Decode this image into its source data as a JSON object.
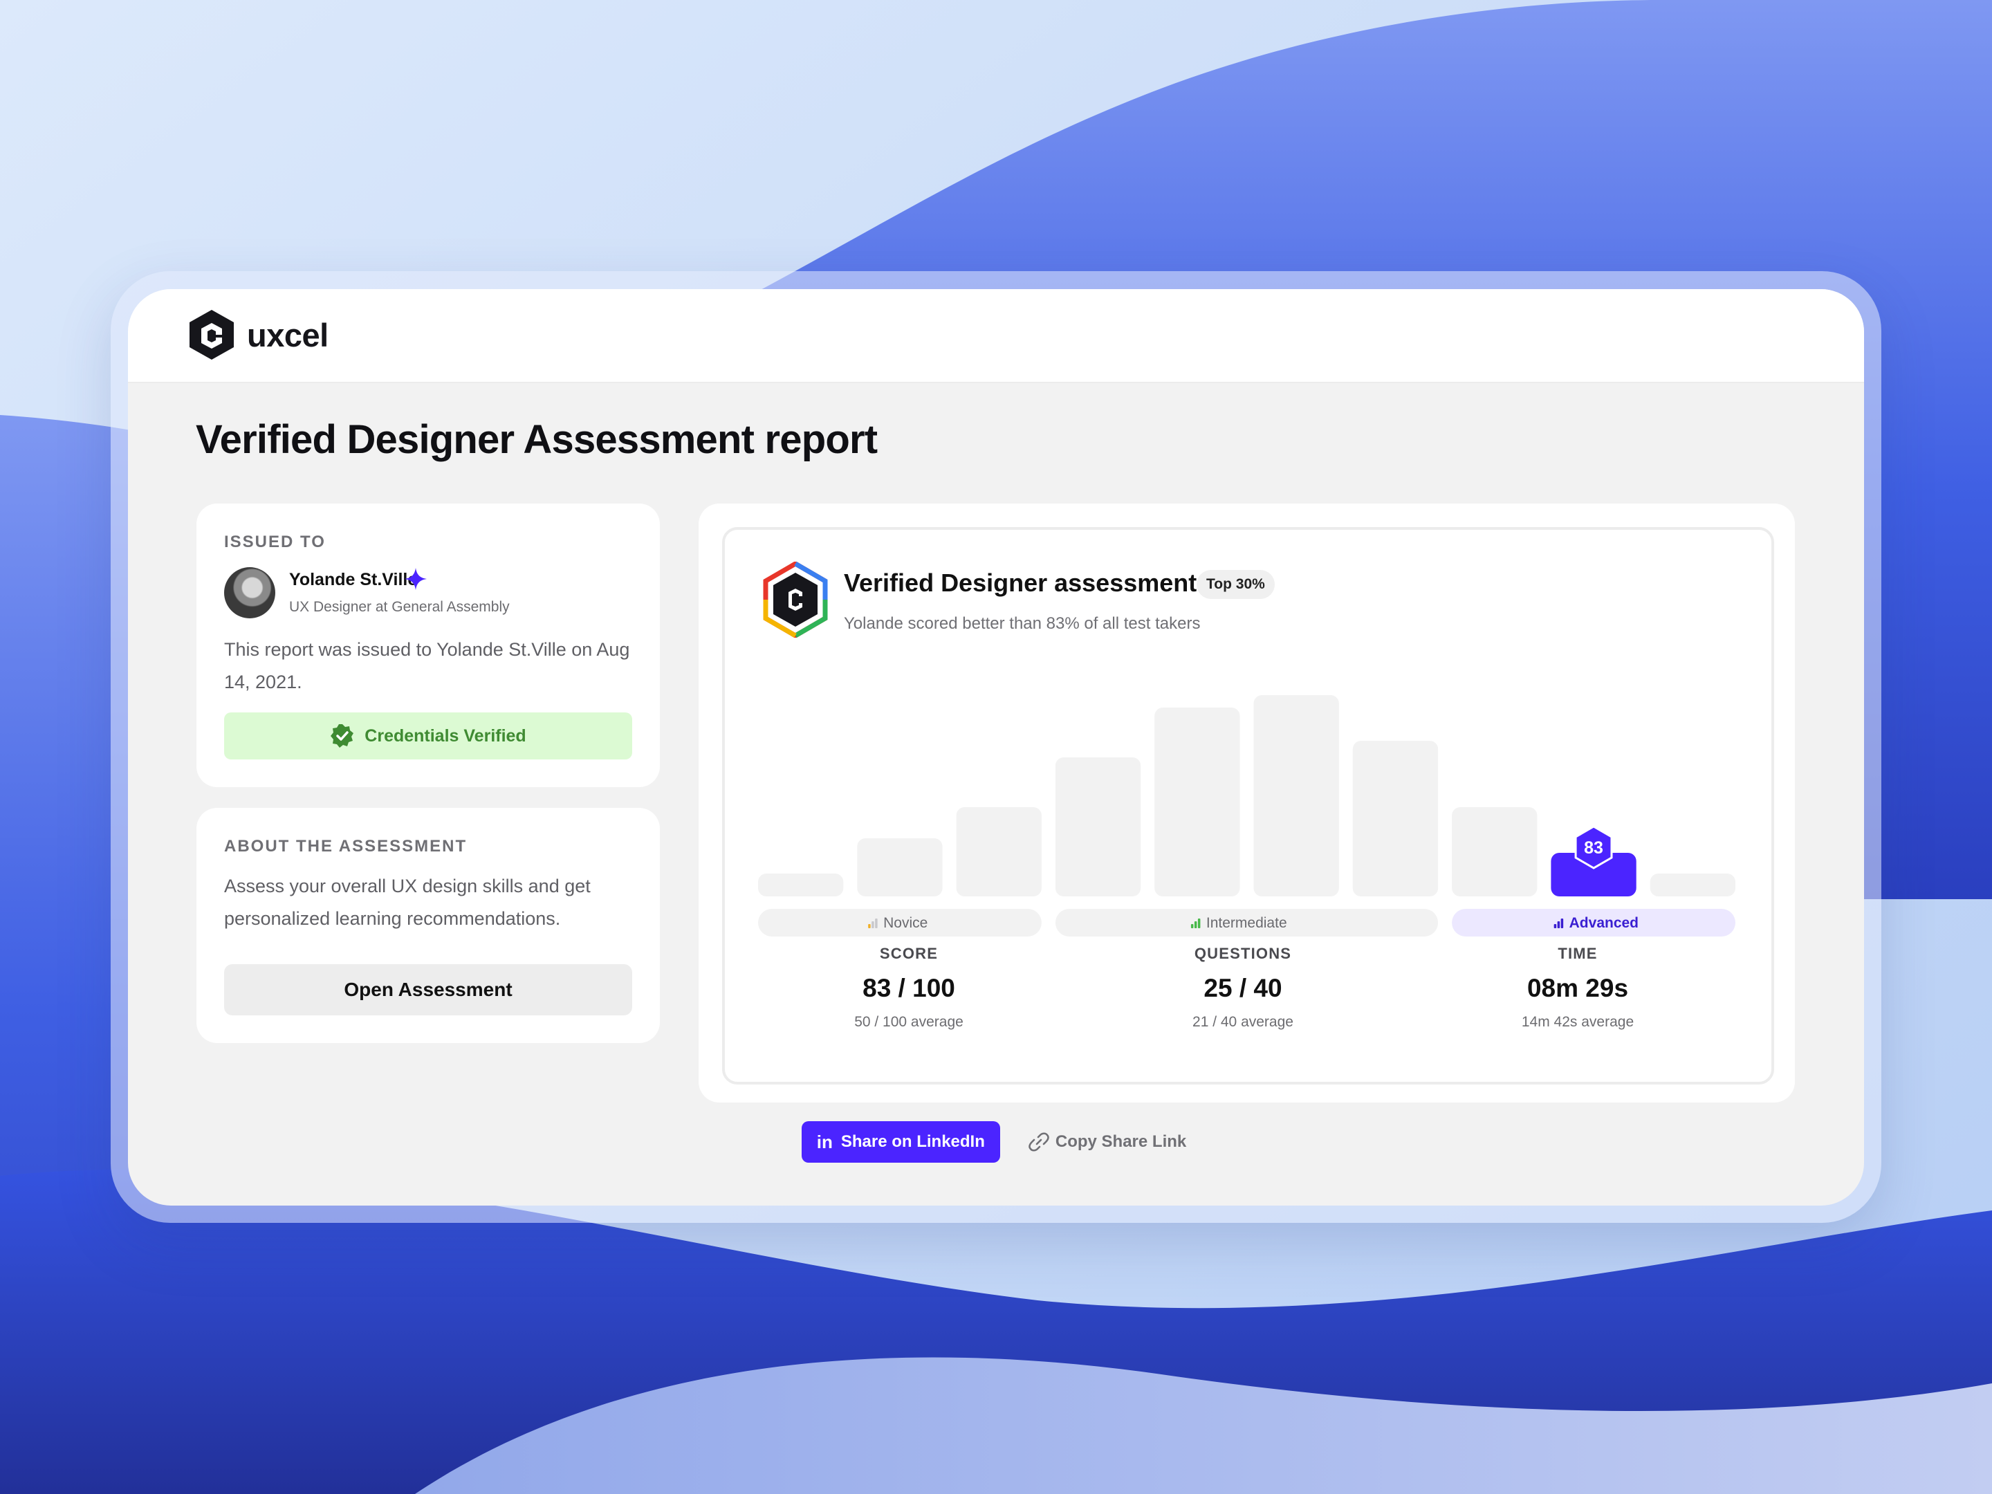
{
  "brand": {
    "name": "uxcel"
  },
  "page": {
    "title": "Verified Designer Assessment report"
  },
  "issued": {
    "eyebrow": "ISSUED TO",
    "user_name": "Yolande St.Ville",
    "user_role": "UX Designer at General Assembly",
    "description": "This report was issued to Yolande St.Ville on Aug 14, 2021.",
    "verified_label": "Credentials Verified"
  },
  "about": {
    "eyebrow": "ABOUT THE ASSESSMENT",
    "description": "Assess your overall UX design skills and get personalized learning recommendations.",
    "button_label": "Open Assessment"
  },
  "report": {
    "title": "Verified Designer assessment",
    "rank_badge": "Top 30%",
    "subtitle": "Yolande scored better than 83% of all test takers"
  },
  "chart_data": {
    "type": "bar",
    "values": [
      0.11,
      0.28,
      0.43,
      0.67,
      0.91,
      0.97,
      0.75,
      0.43,
      0.21,
      0.11
    ],
    "highlight_index": 8,
    "highlight_label": "83",
    "levels": [
      {
        "label": "Novice",
        "start": 0,
        "end": 2
      },
      {
        "label": "Intermediate",
        "start": 3,
        "end": 6
      },
      {
        "label": "Advanced",
        "start": 7,
        "end": 9,
        "active": true
      }
    ]
  },
  "stats": [
    {
      "label": "SCORE",
      "value": "83 / 100",
      "average": "50 / 100 average"
    },
    {
      "label": "QUESTIONS",
      "value": "25 / 40",
      "average": "21 / 40 average"
    },
    {
      "label": "TIME",
      "value": "08m 29s",
      "average": "14m 42s average"
    }
  ],
  "actions": {
    "linkedin_label": "Share on LinkedIn",
    "copy_label": "Copy Share Link"
  },
  "colors": {
    "accent": "#4b24ff",
    "verified_bg": "#dcfad3",
    "verified_text": "#3f8b32",
    "bar": "#f2f2f2",
    "advanced_bg": "#ece8ff"
  },
  "icons": {
    "logo": "uxcel-hexagon-logo",
    "verified": "check-badge-icon",
    "spark": "sparkle-icon",
    "share": "linkedin-icon",
    "copy": "link-icon"
  }
}
